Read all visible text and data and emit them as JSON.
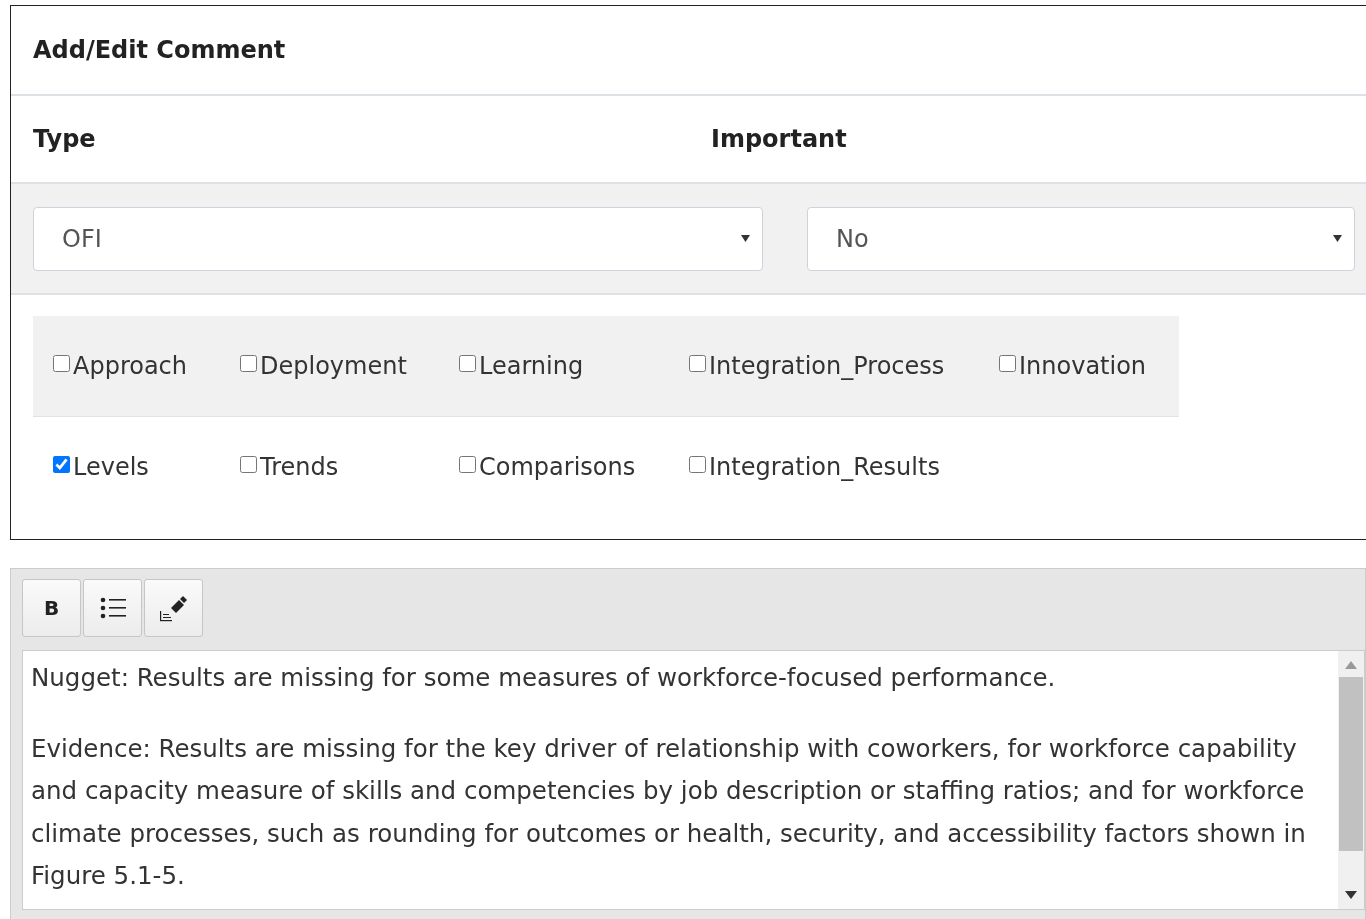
{
  "panel": {
    "title": "Add/Edit Comment"
  },
  "fields": [
    {
      "label": "Type",
      "value": "OFI"
    },
    {
      "label": "Important",
      "value": "No"
    }
  ],
  "checkbox_rows": [
    [
      {
        "label": "Approach",
        "checked": false
      },
      {
        "label": "Deployment",
        "checked": false
      },
      {
        "label": "Learning",
        "checked": false
      },
      {
        "label": "Integration_Process",
        "checked": false
      },
      {
        "label": "Innovation",
        "checked": false
      }
    ],
    [
      {
        "label": "Levels",
        "checked": true
      },
      {
        "label": "Trends",
        "checked": false
      },
      {
        "label": "Comparisons",
        "checked": false
      },
      {
        "label": "Integration_Results",
        "checked": false
      }
    ]
  ],
  "toolbar": [
    {
      "kind": "bold",
      "label": "B"
    },
    {
      "kind": "list"
    },
    {
      "kind": "format"
    }
  ],
  "editor": {
    "paragraphs": [
      "Nugget: Results are missing for some measures of workforce-focused performance.",
      "Evidence: Results are missing for the key driver of relationship with coworkers, for workforce capability and capacity measure of skills and competencies by job description or staffing ratios; and for workforce climate processes, such as rounding for outcomes or health, security, and accessibility factors shown in Figure 5.1-5."
    ]
  }
}
